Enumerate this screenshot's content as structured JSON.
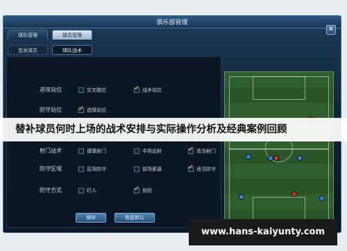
{
  "window": {
    "title": "俱乐部管理",
    "close_glyph": "✕"
  },
  "top_tabs": [
    {
      "label": "球队管理"
    },
    {
      "label": "球员管理"
    }
  ],
  "sub_tabs": [
    {
      "label": "首发球员"
    },
    {
      "label": "球队战术"
    }
  ],
  "tactics": [
    {
      "label": "进攻站位",
      "options": [
        {
          "label": "交叉跑位",
          "checked": false
        },
        {
          "label": "战术站位",
          "checked": true
        }
      ]
    },
    {
      "label": "防守站位",
      "options": [
        {
          "label": "选择站位",
          "checked": true
        }
      ]
    },
    {
      "label": "射门战术",
      "options": [
        {
          "label": "谨慎射门",
          "checked": false
        },
        {
          "label": "中场远射",
          "checked": false
        },
        {
          "label": "适当射门",
          "checked": true
        }
      ]
    },
    {
      "label": "防守区域",
      "options": [
        {
          "label": "后场防守",
          "checked": false
        },
        {
          "label": "前场紧逼",
          "checked": false
        },
        {
          "label": "适当防守",
          "checked": true
        }
      ]
    },
    {
      "label": "防守方式",
      "options": [
        {
          "label": "盯人",
          "checked": false
        },
        {
          "label": "协防",
          "checked": true
        }
      ]
    }
  ],
  "buttons": {
    "save": "保存",
    "restore_default": "恢复默认"
  },
  "banner": "替补球员何时上场的战术安排与实际操作分析及经典案例回顾",
  "watermark": "www.hans-kaiyunty.com",
  "colors": {
    "home_team": "#c0392b",
    "away_team": "#2e86de"
  }
}
